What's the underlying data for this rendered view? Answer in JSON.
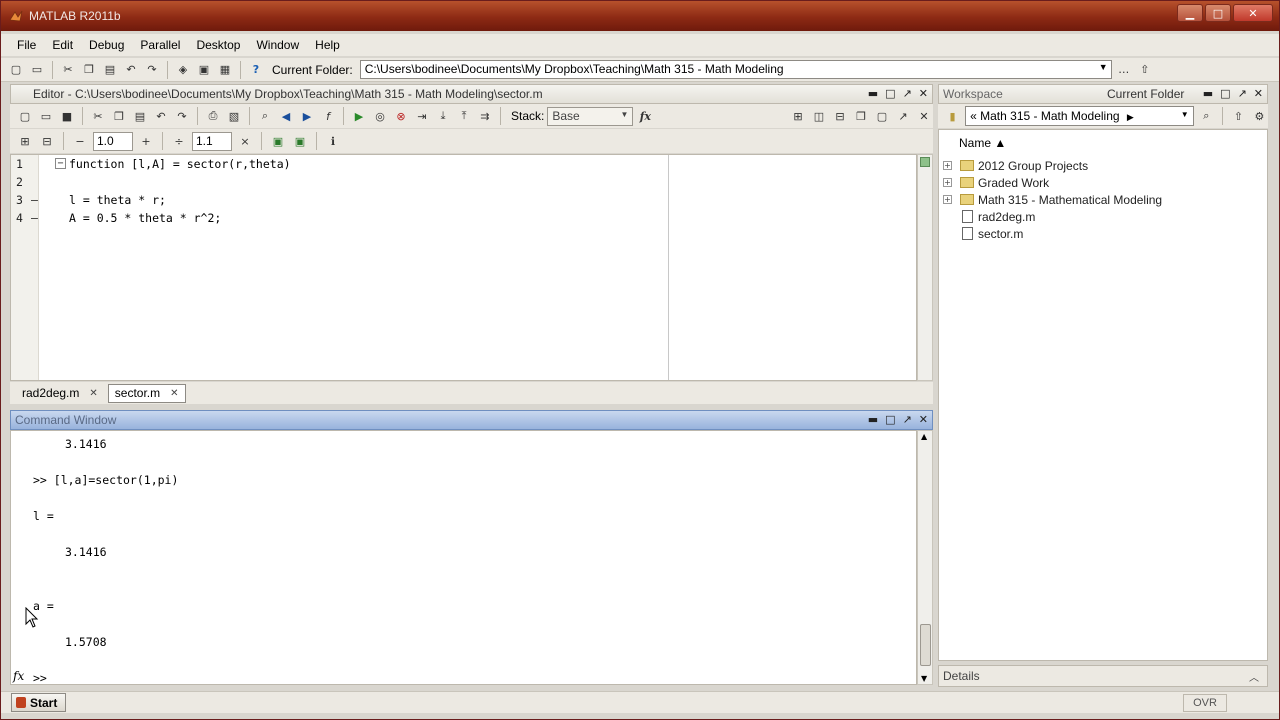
{
  "window": {
    "title": "MATLAB  R2011b"
  },
  "menu": [
    "File",
    "Edit",
    "Debug",
    "Parallel",
    "Desktop",
    "Window",
    "Help"
  ],
  "toolbar": {
    "current_folder_label": "Current Folder:",
    "current_folder_path": "C:\\Users\\bodinee\\Documents\\My Dropbox\\Teaching\\Math 315 - Math Modeling"
  },
  "editor": {
    "title": "Editor - C:\\Users\\bodinee\\Documents\\My Dropbox\\Teaching\\Math 315 - Math Modeling\\sector.m",
    "stack_label": "Stack:",
    "stack_value": "Base",
    "fx_label": "fx",
    "cell_minus": "−",
    "cell_value_1": "1.0",
    "cell_plus": "+",
    "cell_divide": "÷",
    "cell_value_2": "1.1",
    "cell_times": "×",
    "lines": [
      {
        "num": "1",
        "dash": "",
        "text": "function [l,A] = sector(r,theta)"
      },
      {
        "num": "2",
        "dash": "",
        "text": ""
      },
      {
        "num": "3",
        "dash": "–",
        "text": "l = theta * r;"
      },
      {
        "num": "4",
        "dash": "–",
        "text": "A = 0.5 * theta * r^2;"
      }
    ],
    "tabs": [
      {
        "label": "rad2deg.m",
        "active": false
      },
      {
        "label": "sector.m",
        "active": true
      }
    ]
  },
  "command_window": {
    "title": "Command Window",
    "lines": [
      "3.1416",
      ">> [l,a]=sector(1,pi)",
      "l =",
      "3.1416",
      "a =",
      "1.5708"
    ],
    "prompt": ">>",
    "fx": "fx"
  },
  "workspace_pane": {
    "tab_workspace": "Workspace",
    "tab_current_folder": "Current Folder",
    "path_prefix": "«",
    "path": "Math 315 - Math Modeling",
    "column_name": "Name ▲",
    "items": [
      {
        "name": "2012 Group Projects",
        "type": "folder"
      },
      {
        "name": "Graded Work",
        "type": "folder"
      },
      {
        "name": "Math 315 - Mathematical Modeling",
        "type": "folder"
      },
      {
        "name": "rad2deg.m",
        "type": "file"
      },
      {
        "name": "sector.m",
        "type": "file"
      }
    ],
    "details": "Details"
  },
  "statusbar": {
    "start": "Start",
    "ovr": "OVR"
  },
  "colors": {
    "titlebar": "#8d2a14",
    "command_title": "#98b3dd"
  }
}
